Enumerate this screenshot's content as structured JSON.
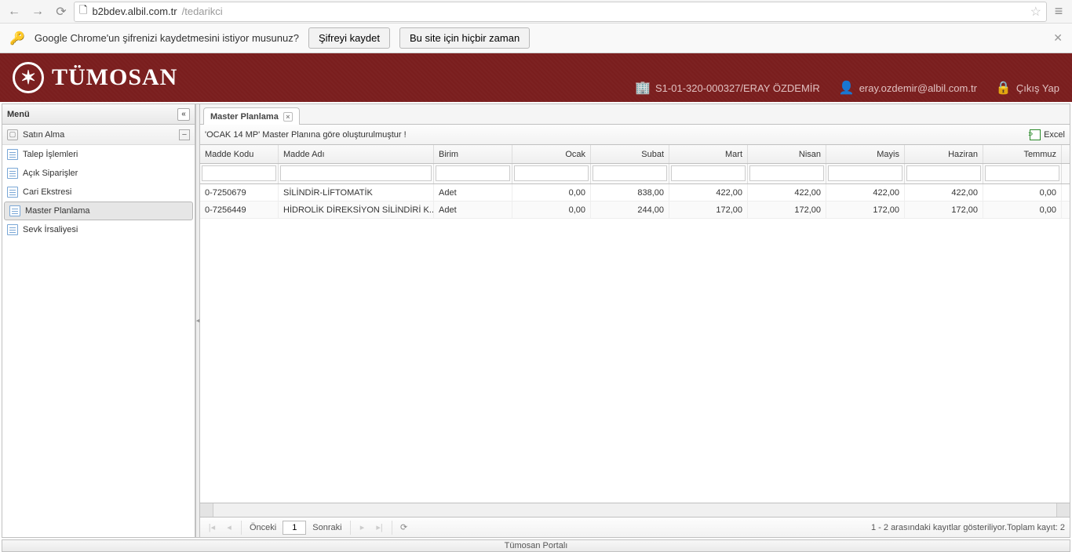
{
  "browser": {
    "url_domain": "b2bdev.albil.com.tr",
    "url_path": "/tedarikci"
  },
  "infobar": {
    "text": "Google Chrome'un şifrenizi kaydetmesini istiyor musunuz?",
    "save_btn": "Şifreyi kaydet",
    "never_btn": "Bu site için hiçbir zaman"
  },
  "header": {
    "logo_text": "TÜMOSAN",
    "company_info": "S1-01-320-000327/ERAY ÖZDEMİR",
    "user_email": "eray.ozdemir@albil.com.tr",
    "logout": "Çıkış Yap"
  },
  "sidebar": {
    "title": "Menü",
    "accordion": "Satın Alma",
    "items": [
      {
        "label": "Talep İşlemleri"
      },
      {
        "label": "Açık Siparişler"
      },
      {
        "label": "Cari Ekstresi"
      },
      {
        "label": "Master Planlama"
      },
      {
        "label": "Sevk İrsaliyesi"
      }
    ]
  },
  "tab": {
    "label": "Master Planlama"
  },
  "toolbar": {
    "info": "'OCAK 14 MP' Master Planına göre oluşturulmuştur !",
    "excel": "Excel"
  },
  "grid": {
    "columns": [
      "Madde Kodu",
      "Madde Adı",
      "Birim",
      "Ocak",
      "Subat",
      "Mart",
      "Nisan",
      "Mayis",
      "Haziran",
      "Temmuz"
    ],
    "rows": [
      {
        "kod": "0-7250679",
        "ad": "SİLİNDİR-LİFTOMATİK",
        "birim": "Adet",
        "vals": [
          "0,00",
          "838,00",
          "422,00",
          "422,00",
          "422,00",
          "422,00",
          "0,00"
        ]
      },
      {
        "kod": "0-7256449",
        "ad": "HİDROLİK DİREKSİYON SİLİNDİRİ K...",
        "birim": "Adet",
        "vals": [
          "0,00",
          "244,00",
          "172,00",
          "172,00",
          "172,00",
          "172,00",
          "0,00"
        ]
      }
    ]
  },
  "pager": {
    "prev": "Önceki",
    "page": "1",
    "next": "Sonraki",
    "info": "1 - 2 arasındaki kayıtlar gösteriliyor.Toplam kayıt: 2"
  },
  "footer": "Tümosan Portalı",
  "chart_data": {
    "type": "table",
    "columns": [
      "Madde Kodu",
      "Madde Adı",
      "Birim",
      "Ocak",
      "Subat",
      "Mart",
      "Nisan",
      "Mayis",
      "Haziran",
      "Temmuz"
    ],
    "rows": [
      [
        "0-7250679",
        "SİLİNDİR-LİFTOMATİK",
        "Adet",
        0.0,
        838.0,
        422.0,
        422.0,
        422.0,
        422.0,
        0.0
      ],
      [
        "0-7256449",
        "HİDROLİK DİREKSİYON SİLİNDİRİ K...",
        "Adet",
        0.0,
        244.0,
        172.0,
        172.0,
        172.0,
        172.0,
        0.0
      ]
    ]
  }
}
